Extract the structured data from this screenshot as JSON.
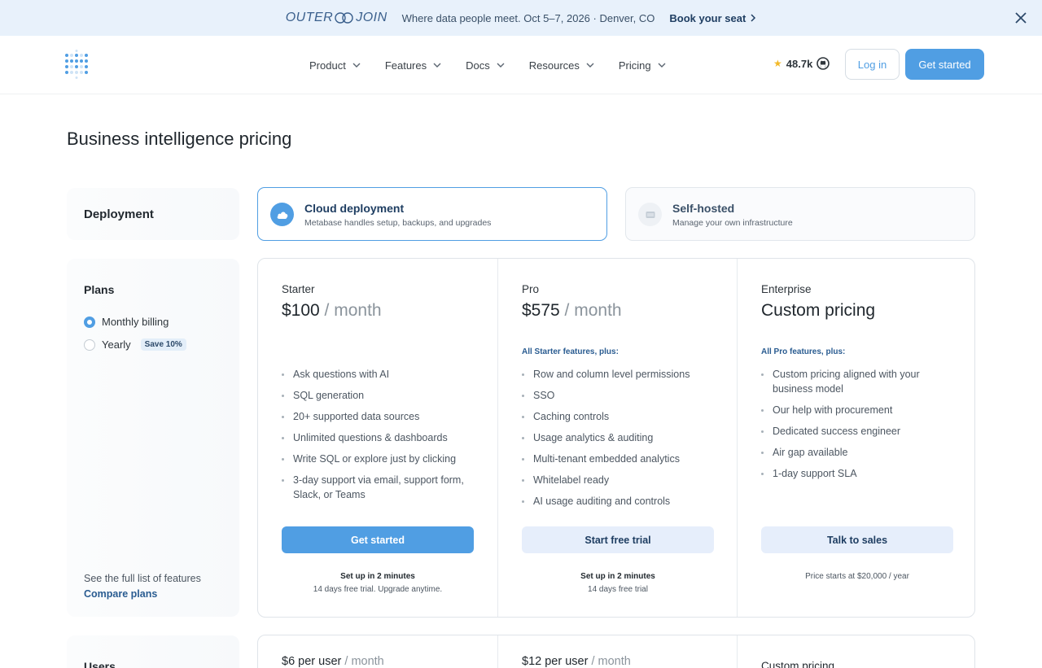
{
  "banner": {
    "logo_left": "OUTER",
    "logo_right": "JOIN",
    "text": "Where data people meet. Oct 5–7, 2026 · Denver, CO",
    "link": "Book your seat"
  },
  "nav": {
    "items": [
      {
        "label": "Product"
      },
      {
        "label": "Features"
      },
      {
        "label": "Docs"
      },
      {
        "label": "Resources"
      },
      {
        "label": "Pricing"
      }
    ],
    "github_stars": "48.7k",
    "login": "Log in",
    "get_started": "Get started"
  },
  "page": {
    "title": "Business intelligence pricing"
  },
  "deployment": {
    "label": "Deployment",
    "options": [
      {
        "title": "Cloud deployment",
        "subtitle": "Metabase handles setup, backups, and upgrades"
      },
      {
        "title": "Self-hosted",
        "subtitle": "Manage your own infrastructure"
      }
    ]
  },
  "billing": {
    "label": "Plans",
    "monthly": "Monthly billing",
    "yearly": "Yearly",
    "save_badge": "Save 10%",
    "footer_text": "See the full list of features",
    "compare_link": "Compare plans"
  },
  "plans": [
    {
      "name": "Starter",
      "price": "$100",
      "per": " / month",
      "plus": "",
      "features": [
        "Ask questions with AI",
        "SQL generation",
        "20+ supported data sources",
        "Unlimited questions & dashboards",
        "Write SQL or explore just by clicking",
        "3-day support via email, support form, Slack, or Teams"
      ],
      "button": "Get started",
      "foot_strong": "Set up in 2 minutes",
      "foot": "14 days free trial. Upgrade anytime."
    },
    {
      "name": "Pro",
      "price": "$575",
      "per": " / month",
      "plus": "All Starter features, plus:",
      "features": [
        "Row and column level permissions",
        "SSO",
        "Caching controls",
        "Usage analytics & auditing",
        "Multi-tenant embedded analytics",
        "Whitelabel ready",
        "AI usage auditing and controls"
      ],
      "button": "Start free trial",
      "foot_strong": "Set up in 2 minutes",
      "foot": "14 days free trial"
    },
    {
      "name": "Enterprise",
      "price": "Custom pricing",
      "per": "",
      "plus": "All Pro features, plus:",
      "features": [
        "Custom pricing aligned with your business model",
        "Our help with procurement",
        "Dedicated success engineer",
        "Air gap available",
        "1-day support SLA"
      ],
      "button": "Talk to sales",
      "foot_strong": "",
      "foot": "Price starts at $20,000 / year"
    }
  ],
  "users": {
    "label": "Users",
    "prices": [
      {
        "price": "$6 per user",
        "per": " / month"
      },
      {
        "price": "$12 per user",
        "per": " / month"
      },
      {
        "price": "Custom pricing",
        "per": ""
      }
    ]
  }
}
